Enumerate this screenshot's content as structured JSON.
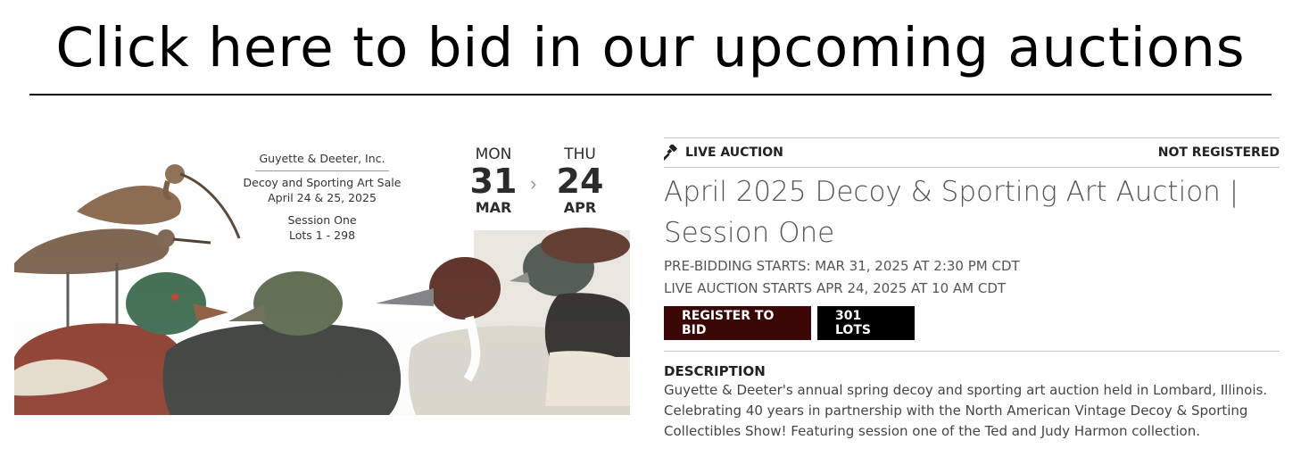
{
  "banner": {
    "text": "Click here to bid in our upcoming auctions"
  },
  "promo": {
    "company": "Guyette & Deeter, Inc.",
    "sale_name": "Decoy and Sporting Art Sale",
    "sale_dates": "April 24 & 25, 2025",
    "session": "Session One",
    "lots": "Lots 1 - 298",
    "start": {
      "day": "MON",
      "num": "31",
      "month": "MAR"
    },
    "end": {
      "day": "THU",
      "num": "24",
      "month": "APR"
    }
  },
  "auction": {
    "type_label": "LIVE AUCTION",
    "registration_status": "NOT REGISTERED",
    "title": "April 2025 Decoy & Sporting Art Auction | Session One",
    "prebid": "PRE-BIDDING STARTS: MAR 31, 2025 AT 2:30 PM CDT",
    "live_start": "LIVE AUCTION STARTS APR 24, 2025 AT 10 AM CDT",
    "register_button": "REGISTER TO BID",
    "lots_button": "301 LOTS",
    "description_heading": "DESCRIPTION",
    "description": "Guyette & Deeter's annual spring decoy and sporting art auction held in Lombard, Illinois. Celebrating 40 years in partnership with the North American Vintage Decoy & Sporting Collectibles Show! Featuring session one of the Ted and Judy Harmon collection."
  },
  "colors": {
    "register_bg": "#3b0606",
    "lots_bg": "#000000"
  },
  "icons": {
    "auction": "gavel-icon"
  }
}
